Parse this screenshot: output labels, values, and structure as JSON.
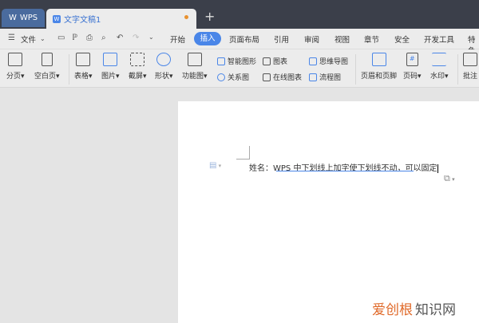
{
  "tabs": {
    "wps": "WPS",
    "doc": "文字文稿1",
    "new": "+"
  },
  "menu": {
    "file": "文件",
    "items": [
      "开始",
      "插入",
      "页面布局",
      "引用",
      "审阅",
      "视图",
      "章节",
      "安全",
      "开发工具",
      "特色"
    ],
    "active": "插入"
  },
  "ribbon": {
    "big": [
      "分页",
      "空白页",
      "表格",
      "图片",
      "截屏",
      "形状",
      "功能图"
    ],
    "small": [
      "智能图形",
      "关系图",
      "图表",
      "在线图表",
      "思维导图",
      "流程图"
    ],
    "big2": [
      "页眉和页脚",
      "页码",
      "水印",
      "批注"
    ]
  },
  "document": {
    "text_prefix": "姓名：",
    "text_body": "WPS 中下划线上加字使下划线不动，可以固定"
  },
  "watermark": {
    "part1": "爱创根",
    "part2": "知识网"
  },
  "colors": {
    "accent": "#4a86e8",
    "titlebar": "#3b3f4a"
  }
}
